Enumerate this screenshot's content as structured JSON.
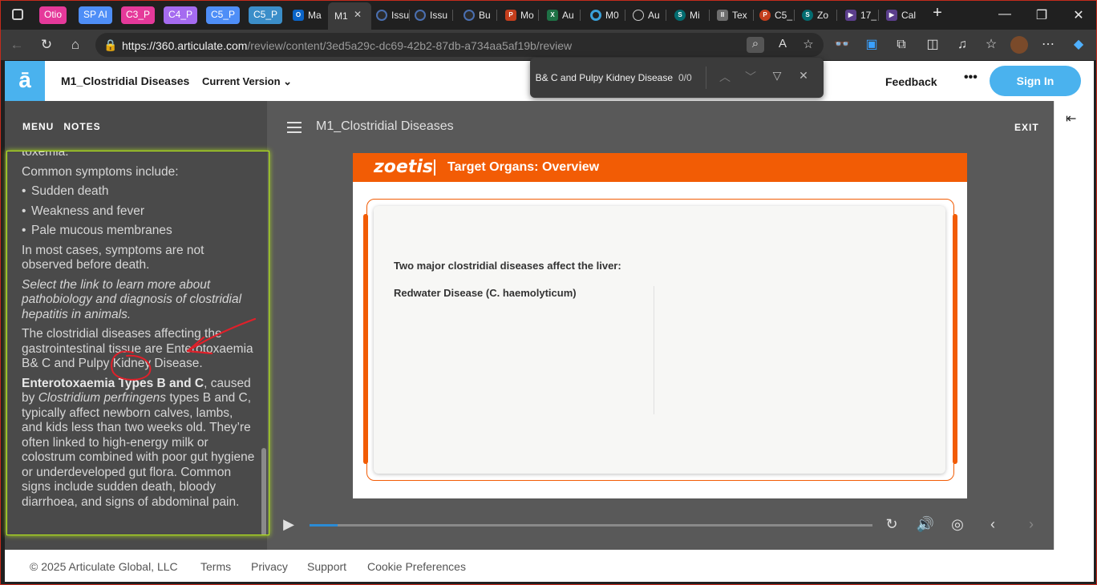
{
  "browser": {
    "tabs": [
      {
        "label": "Otio",
        "color": "#e5399a",
        "kind": "group"
      },
      {
        "label": "SP AI",
        "color": "#4e8ef7",
        "kind": "group"
      },
      {
        "label": "C3_P",
        "color": "#e5399a",
        "kind": "group"
      },
      {
        "label": "C4_P",
        "color": "#a56bf0",
        "kind": "group"
      },
      {
        "label": "C5_P",
        "color": "#4e8ef7",
        "kind": "group"
      },
      {
        "label": "C5_P",
        "color": "#3b8ec9",
        "kind": "group"
      },
      {
        "label": "Ma",
        "kind": "page"
      },
      {
        "label": "M1",
        "kind": "page",
        "active": true
      },
      {
        "label": "Issu",
        "kind": "page"
      },
      {
        "label": "Issu",
        "kind": "page"
      },
      {
        "label": "Bu",
        "kind": "page"
      },
      {
        "label": "Mo",
        "kind": "page"
      },
      {
        "label": "Au",
        "kind": "page"
      },
      {
        "label": "M0",
        "kind": "page"
      },
      {
        "label": "Au",
        "kind": "page"
      },
      {
        "label": "Mi",
        "kind": "page"
      },
      {
        "label": "Tex",
        "kind": "page"
      },
      {
        "label": "C5_",
        "kind": "page"
      },
      {
        "label": "Zo",
        "kind": "page"
      },
      {
        "label": "17_",
        "kind": "page"
      },
      {
        "label": "Cal",
        "kind": "page"
      }
    ],
    "new_tab": "+",
    "minimize": "—",
    "restore": "❐",
    "close": "✕",
    "url_host": "https://360.articulate.com",
    "url_path": "/review/content/3ed5a29c-dc69-42b2-87db-a734aa5af19b/review"
  },
  "find": {
    "query": "B& C and Pulpy Kidney Disease.",
    "count": "0/0"
  },
  "header": {
    "logo": "ā",
    "course_title": "M1_Clostridial Diseases",
    "version_label": "Current Version",
    "feedback": "Feedback",
    "more": "•••",
    "signin": "Sign In"
  },
  "sidebar": {
    "tab_menu": "MENU",
    "tab_notes": "NOTES",
    "notes": {
      "p0": "toxemia.",
      "p1": "Common symptoms include:",
      "bullets": [
        "Sudden death",
        "Weakness and fever",
        "Pale mucous membranes"
      ],
      "p2": "In most cases, symptoms are not observed before death.",
      "p3": "Select the link to learn more about pathobiology and diagnosis of clostridial hepatitis in animals.",
      "p4": "The clostridial diseases affecting the gastrointestinal tissue are Enterotoxaemia B& C and Pulpy Kidney Disease.",
      "p5_bold": "Enterotoxaemia Types B and C",
      "p5_a": ", caused by ",
      "p5_italic": "Clostridium perfringens",
      "p5_b": " types B and C, typically affect newborn calves, lambs, and kids less than two weeks old. They’re often linked to high-energy milk or colostrum combined with poor gut hygiene or underdeveloped gut flora. Common signs include sudden death, bloody diarrhoea, and signs of abdominal pain."
    }
  },
  "player": {
    "slide_menu_title": "M1_Clostridial Diseases",
    "exit": "EXIT",
    "progress": 0.05
  },
  "slide": {
    "brand": "zoetis",
    "title": "Target Organs: Overview",
    "heading": "Two major clostridial diseases affect the liver:",
    "item": "Redwater Disease (C. haemolyticum)",
    "accent": "#f25c05"
  },
  "footer": {
    "copyright": "© 2025 Articulate Global, LLC",
    "terms": "Terms",
    "privacy": "Privacy",
    "support": "Support",
    "cookies": "Cookie Preferences"
  },
  "colors": {
    "articulate_blue": "#4ab2ee",
    "notes_highlight": "#b4e61e",
    "annotation_red": "#e0202a"
  }
}
